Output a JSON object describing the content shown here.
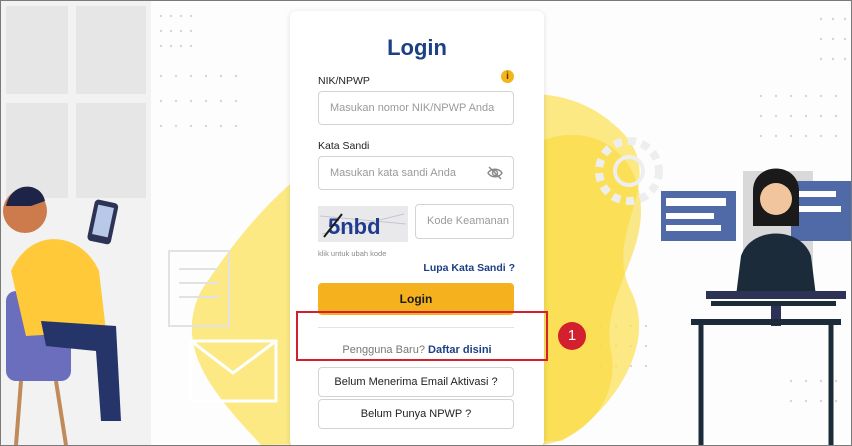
{
  "login": {
    "title": "Login",
    "nik_label": "NIK/NPWP",
    "info_icon": "i",
    "nik_placeholder": "Masukan nomor NIK/NPWP Anda",
    "password_label": "Kata Sandi",
    "password_placeholder": "Masukan kata sandi Anda",
    "captcha_text": "5nbd",
    "captcha_hint": "klik untuk ubah kode",
    "captcha_placeholder": "Kode Keamanan",
    "forgot_link": "Lupa Kata Sandi ?",
    "login_button": "Login",
    "new_user_text": "Pengguna Baru?",
    "register_link": "Daftar disini",
    "activation_button": "Belum Menerima Email Aktivasi ?",
    "no_npwp_button": "Belum Punya NPWP ?"
  },
  "annotation": {
    "badge": "1",
    "color": "#d2202f"
  },
  "colors": {
    "accent": "#f5b21e",
    "brand_blue": "#1c3f85"
  },
  "icons": [
    "info-icon",
    "eye-off-icon"
  ]
}
